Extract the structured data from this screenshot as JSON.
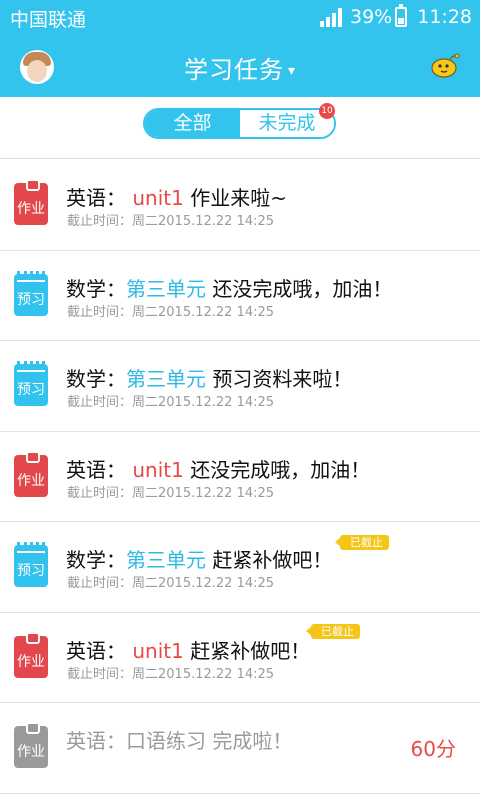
{
  "status_bar": {
    "carrier": "中国联通",
    "battery": "39%",
    "time": "11:28",
    "battery_level": 0.39
  },
  "header": {
    "title": "学习任务",
    "caret": "▾",
    "avatar_icon": "user-avatar",
    "mascot_icon": "chick-mascot-icon"
  },
  "tabs": {
    "all_label": "全部",
    "incomplete_label": "未完成",
    "incomplete_count": "10"
  },
  "colors": {
    "accent": "#33c4ee",
    "red": "#e84a4a",
    "tag_yellow": "#f5c518"
  },
  "tasks": [
    {
      "icon_label": "作业",
      "icon_type": "homework",
      "subject": "英语：",
      "unit": "unit1",
      "message": "作业来啦~",
      "deadline": "截止时间：周二2015.12.22 14:25"
    },
    {
      "icon_label": "预习",
      "icon_type": "preview",
      "subject": "数学：",
      "unit": "第三单元",
      "message": "还没完成哦，加油！",
      "deadline": "截止时间：周二2015.12.22 14:25"
    },
    {
      "icon_label": "预习",
      "icon_type": "preview",
      "subject": "数学：",
      "unit": "第三单元",
      "message": "预习资料来啦！",
      "deadline": "截止时间：周二2015.12.22 14:25"
    },
    {
      "icon_label": "作业",
      "icon_type": "homework",
      "subject": "英语：",
      "unit": "unit1",
      "message": "还没完成哦，加油！",
      "deadline": "截止时间：周二2015.12.22 14:25"
    },
    {
      "icon_label": "预习",
      "icon_type": "preview",
      "subject": "数学：",
      "unit": "第三单元",
      "message": "赶紧补做吧！",
      "deadline": "截止时间：周二2015.12.22 14:25",
      "tag": "已截止"
    },
    {
      "icon_label": "作业",
      "icon_type": "homework",
      "subject": "英语：",
      "unit": "unit1",
      "message": "赶紧补做吧！",
      "deadline": "截止时间：周二2015.12.22 14:25",
      "tag": "已截止"
    },
    {
      "icon_label": "作业",
      "icon_type": "homework-done",
      "subject": "英语：",
      "unit": "口语练习",
      "message": "完成啦！",
      "score": "60分"
    }
  ]
}
